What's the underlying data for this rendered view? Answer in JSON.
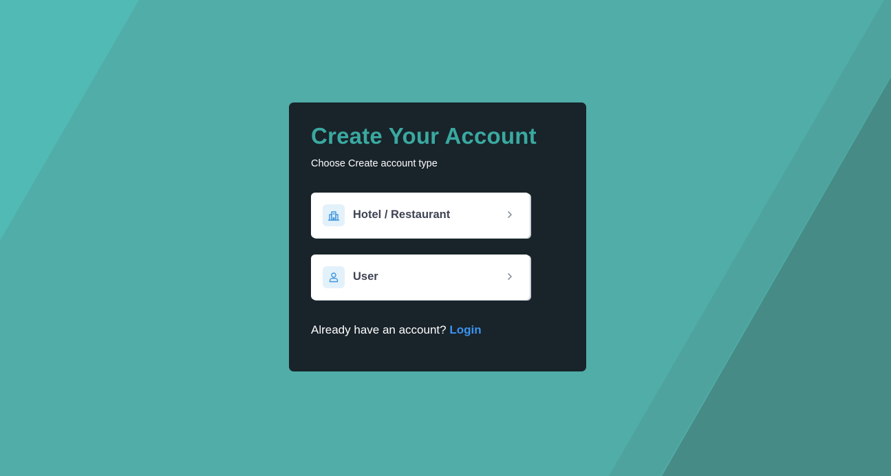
{
  "page": {
    "title": "Create Your Account",
    "subtitle": "Choose Create account type"
  },
  "options": [
    {
      "label": "Hotel / Restaurant",
      "icon": "building-icon"
    },
    {
      "label": "User",
      "icon": "user-icon"
    }
  ],
  "footer": {
    "prompt": "Already have an account?",
    "link_label": "Login"
  },
  "colors": {
    "background": "#50ada8",
    "card": "#19232a",
    "accent": "#3aa9a0",
    "link": "#3b93ee"
  }
}
